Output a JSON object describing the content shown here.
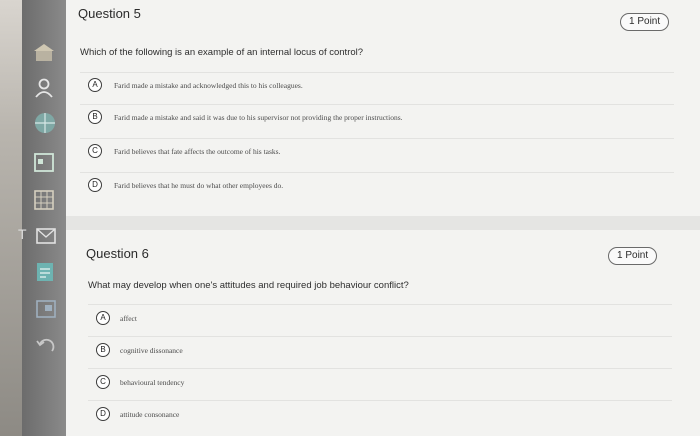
{
  "questions": [
    {
      "title": "Question 5",
      "points": "1 Point",
      "prompt": "Which of the following is an example of an internal locus of control?",
      "options": [
        {
          "letter": "A",
          "text": "Farid made a mistake and acknowledged this to his colleagues."
        },
        {
          "letter": "B",
          "text": "Farid made a mistake and said it was due to his supervisor not providing the proper instructions."
        },
        {
          "letter": "C",
          "text": "Farid believes that fate affects the outcome of his tasks."
        },
        {
          "letter": "D",
          "text": "Farid believes that he must do what other employees do."
        }
      ]
    },
    {
      "title": "Question 6",
      "points": "1 Point",
      "prompt": "What may develop when one's attitudes and required job behaviour conflict?",
      "options": [
        {
          "letter": "A",
          "text": "affect"
        },
        {
          "letter": "B",
          "text": "cognitive dissonance"
        },
        {
          "letter": "C",
          "text": "behavioural tendency"
        },
        {
          "letter": "D",
          "text": "attitude consonance"
        }
      ]
    }
  ],
  "sidebar": {
    "letter": "T",
    "icons": [
      "home-icon",
      "user-icon",
      "globe-icon",
      "calendar-icon",
      "grid-icon",
      "mail-icon",
      "document-icon",
      "window-icon",
      "undo-icon"
    ]
  }
}
